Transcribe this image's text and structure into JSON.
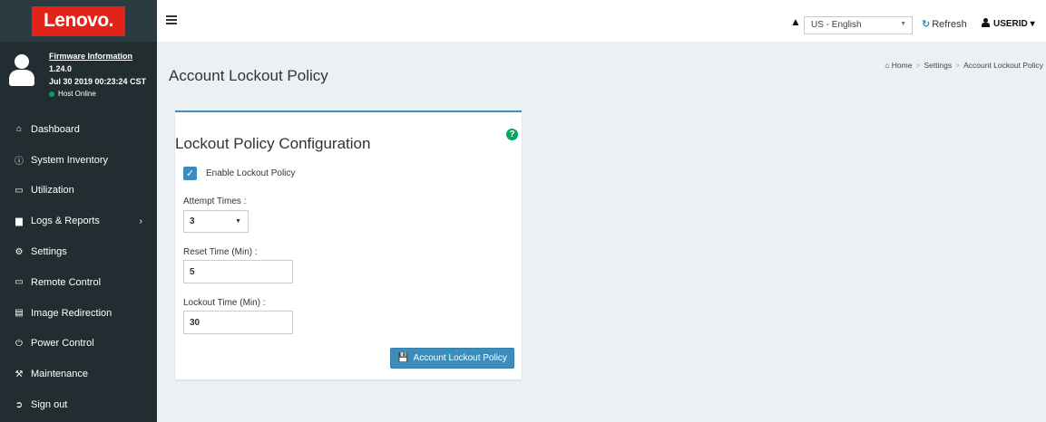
{
  "brand": {
    "logo_text": "Lenovo.",
    "logo_color": "#e2231a"
  },
  "user_panel": {
    "firmware_link": "Firmware Information",
    "version": "1.24.0",
    "datetime": "Jul 30 2019 00:23:24 CST",
    "host_status": "Host Online",
    "host_status_color": "#00a65a"
  },
  "sidebar": {
    "items": [
      {
        "label": "Dashboard",
        "icon": "home-icon"
      },
      {
        "label": "System Inventory",
        "icon": "info-icon"
      },
      {
        "label": "Utilization",
        "icon": "laptop-icon"
      },
      {
        "label": "Logs & Reports",
        "icon": "bar-chart-icon"
      },
      {
        "label": "Settings",
        "icon": "gear-icon"
      },
      {
        "label": "Remote Control",
        "icon": "monitor-icon"
      },
      {
        "label": "Image Redirection",
        "icon": "hdd-icon"
      },
      {
        "label": "Power Control",
        "icon": "power-icon"
      },
      {
        "label": "Maintenance",
        "icon": "wrench-icon"
      },
      {
        "label": "Sign out",
        "icon": "sign-out-icon"
      }
    ]
  },
  "topbar": {
    "language": "US - English",
    "refresh_label": "Refresh",
    "user_label": "USERID"
  },
  "page": {
    "title": "Account Lockout Policy",
    "breadcrumb": [
      "Home",
      "Settings",
      "Account Lockout Policy"
    ]
  },
  "form": {
    "title": "Lockout Policy Configuration",
    "enable_label": "Enable Lockout Policy",
    "enable_checked": true,
    "attempt_label": "Attempt Times :",
    "attempt_value": "3",
    "reset_label": "Reset Time (Min) :",
    "reset_value": "5",
    "lockout_label": "Lockout Time (Min) :",
    "lockout_value": "30",
    "save_label": "Account Lockout Policy"
  },
  "colors": {
    "accent": "#3c8dbc",
    "sidebar_bg": "#222d32",
    "content_bg": "#ecf0f5"
  }
}
